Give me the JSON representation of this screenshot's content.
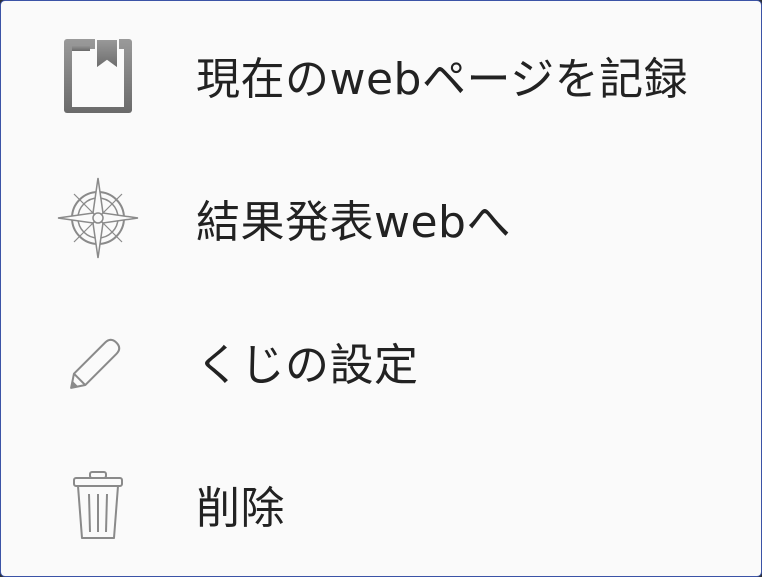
{
  "menu": {
    "items": [
      {
        "label": "現在のwebページを記録",
        "icon": "bookmark-page-icon"
      },
      {
        "label": "結果発表webへ",
        "icon": "compass-icon"
      },
      {
        "label": "くじの設定",
        "icon": "pencil-icon"
      },
      {
        "label": "削除",
        "icon": "trash-icon"
      }
    ]
  },
  "colors": {
    "menu_background": "#fafafa",
    "text": "#222222",
    "icon_gray": "#8a8a8a",
    "frame_border": "#3b53a6"
  }
}
